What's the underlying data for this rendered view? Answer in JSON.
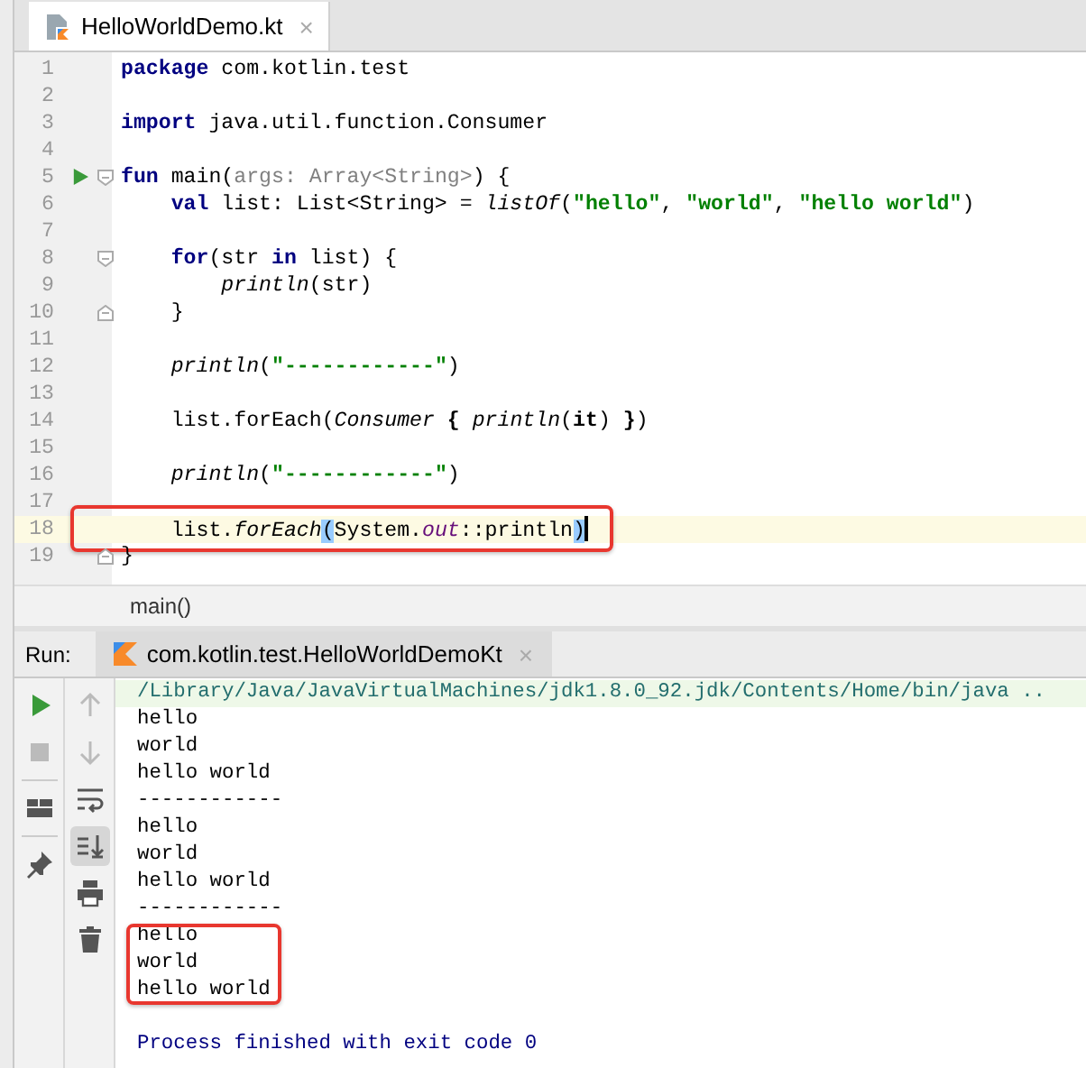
{
  "editor_tab": {
    "title": "HelloWorldDemo.kt",
    "close": "×",
    "selected": true
  },
  "code_lines": [
    {
      "number": "1",
      "tokens": [
        {
          "kind": "kw",
          "text": "package"
        },
        {
          "kind": "plain",
          "text": " com.kotlin.test"
        }
      ]
    },
    {
      "number": "2"
    },
    {
      "number": "3",
      "tokens": [
        {
          "kind": "kw",
          "text": "import"
        },
        {
          "kind": "plain",
          "text": " java.util.function.Consumer"
        }
      ]
    },
    {
      "number": "4"
    },
    {
      "number": "5",
      "run": true,
      "fold_open": true,
      "tokens": [
        {
          "kind": "kw",
          "text": "fun"
        },
        {
          "kind": "plain",
          "text": " main("
        },
        {
          "kind": "hint",
          "text": "args: Array<String>"
        },
        {
          "kind": "plain",
          "text": ") {"
        }
      ]
    },
    {
      "number": "6",
      "tokens": [
        {
          "kind": "kw",
          "text": "    val"
        },
        {
          "kind": "plain",
          "text": " list: List<String> = "
        },
        {
          "kind": "fn",
          "text": "listOf"
        },
        {
          "kind": "plain",
          "text": "("
        },
        {
          "kind": "str",
          "text": "\"hello\""
        },
        {
          "kind": "plain",
          "text": ", "
        },
        {
          "kind": "str",
          "text": "\"world\""
        },
        {
          "kind": "plain",
          "text": ", "
        },
        {
          "kind": "str",
          "text": "\"hello world\""
        },
        {
          "kind": "plain",
          "text": ")"
        }
      ]
    },
    {
      "number": "7"
    },
    {
      "number": "8",
      "fold_open": true,
      "tokens": [
        {
          "kind": "kw",
          "text": "    for"
        },
        {
          "kind": "plain",
          "text": "(str "
        },
        {
          "kind": "kw",
          "text": "in"
        },
        {
          "kind": "plain",
          "text": " list) {"
        }
      ]
    },
    {
      "number": "9",
      "tokens": [
        {
          "kind": "fn",
          "text": "        println"
        },
        {
          "kind": "plain",
          "text": "(str)"
        }
      ]
    },
    {
      "number": "10",
      "fold_close": true,
      "tokens": [
        {
          "kind": "plain",
          "text": "    }"
        }
      ]
    },
    {
      "number": "11"
    },
    {
      "number": "12",
      "tokens": [
        {
          "kind": "fn",
          "text": "    println"
        },
        {
          "kind": "plain",
          "text": "("
        },
        {
          "kind": "str",
          "text": "\"------------\""
        },
        {
          "kind": "plain",
          "text": ")"
        }
      ]
    },
    {
      "number": "13"
    },
    {
      "number": "14",
      "tokens": [
        {
          "kind": "plain",
          "text": "    list.forEach("
        },
        {
          "kind": "fn",
          "text": "Consumer "
        },
        {
          "kind": "bold",
          "text": "{"
        },
        {
          "kind": "fn",
          "text": " println"
        },
        {
          "kind": "plain",
          "text": "("
        },
        {
          "kind": "bold",
          "text": "it"
        },
        {
          "kind": "plain",
          "text": ") "
        },
        {
          "kind": "bold",
          "text": "}"
        },
        {
          "kind": "plain",
          "text": ")"
        }
      ]
    },
    {
      "number": "15"
    },
    {
      "number": "16",
      "tokens": [
        {
          "kind": "fn",
          "text": "    println"
        },
        {
          "kind": "plain",
          "text": "("
        },
        {
          "kind": "str",
          "text": "\"------------\""
        },
        {
          "kind": "plain",
          "text": ")"
        }
      ]
    },
    {
      "number": "17"
    },
    {
      "number": "18",
      "current": true,
      "boxed": true,
      "tokens": [
        {
          "kind": "plain",
          "text": "    list."
        },
        {
          "kind": "fn",
          "text": "forEach"
        },
        {
          "kind": "match",
          "text": "("
        },
        {
          "kind": "plain",
          "text": "System."
        },
        {
          "kind": "field",
          "text": "out"
        },
        {
          "kind": "plain",
          "text": "::println"
        },
        {
          "kind": "match",
          "text": ")"
        }
      ]
    },
    {
      "number": "19",
      "fold_close": true,
      "tokens": [
        {
          "kind": "plain",
          "text": "}"
        }
      ]
    }
  ],
  "breadcrumb": "main()",
  "run_panel": {
    "label": "Run:",
    "tab": {
      "title": "com.kotlin.test.HelloWorldDemoKt",
      "close": "×",
      "selected": true
    },
    "toolbar_1": [
      {
        "kind": "run",
        "disabled": false
      },
      {
        "kind": "stop",
        "disabled": true
      },
      {
        "kind": "separator"
      },
      {
        "kind": "layout",
        "disabled": false
      },
      {
        "kind": "separator"
      },
      {
        "kind": "pin",
        "disabled": false
      }
    ],
    "toolbar_2": [
      {
        "kind": "up",
        "disabled": true,
        "selected": false
      },
      {
        "kind": "down",
        "disabled": true,
        "selected": false
      },
      {
        "kind": "wrap",
        "disabled": false,
        "selected": false
      },
      {
        "kind": "scroll-end",
        "disabled": false,
        "selected": true
      },
      {
        "kind": "print",
        "disabled": false,
        "selected": false
      },
      {
        "kind": "trash",
        "disabled": false,
        "selected": false
      }
    ],
    "output": [
      {
        "kind": "command",
        "text": "/Library/Java/JavaVirtualMachines/jdk1.8.0_92.jdk/Contents/Home/bin/java ..",
        "boxed": false
      },
      {
        "kind": "stdout",
        "text": "hello",
        "boxed": false
      },
      {
        "kind": "stdout",
        "text": "world",
        "boxed": false
      },
      {
        "kind": "stdout",
        "text": "hello world",
        "boxed": false
      },
      {
        "kind": "stdout",
        "text": "------------",
        "boxed": false
      },
      {
        "kind": "stdout",
        "text": "hello",
        "boxed": false
      },
      {
        "kind": "stdout",
        "text": "world",
        "boxed": false
      },
      {
        "kind": "stdout",
        "text": "hello world",
        "boxed": false
      },
      {
        "kind": "stdout",
        "text": "------------",
        "boxed": false
      },
      {
        "kind": "stdout",
        "text": "hello",
        "boxed": true
      },
      {
        "kind": "stdout",
        "text": "world",
        "boxed": true
      },
      {
        "kind": "stdout",
        "text": "hello world",
        "boxed": true
      },
      {
        "kind": "exit",
        "text": "Process finished with exit code 0",
        "boxed": false
      }
    ]
  }
}
